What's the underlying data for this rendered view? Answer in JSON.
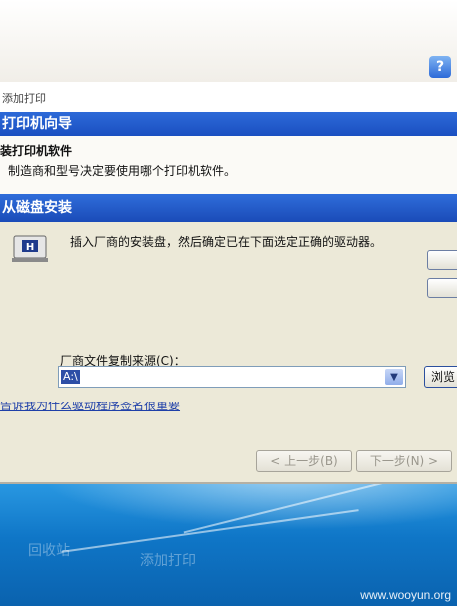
{
  "titlebar": {
    "help_label": "?"
  },
  "header": {
    "crumb": "添加打印"
  },
  "wizard": {
    "title": "打印机向导",
    "heading": "装打印机软件",
    "description": "制造商和型号决定要使用哪个打印机软件。"
  },
  "dialog": {
    "title": "从磁盘安装",
    "instruction": "插入厂商的安装盘，然后确定已在下面选定正确的驱动器。",
    "source_label": "厂商文件复制来源(C)：",
    "source_value": "A:\\",
    "browse_label": "浏览",
    "link_text": "告诉我为什么驱动程序签名很重要"
  },
  "nav": {
    "back_label": "< 上一步(B)",
    "next_label": "下一步(N) >"
  },
  "desktop": {
    "label_1": "回收站",
    "label_2": "添加打印"
  },
  "watermark": "www.wooyun.org"
}
